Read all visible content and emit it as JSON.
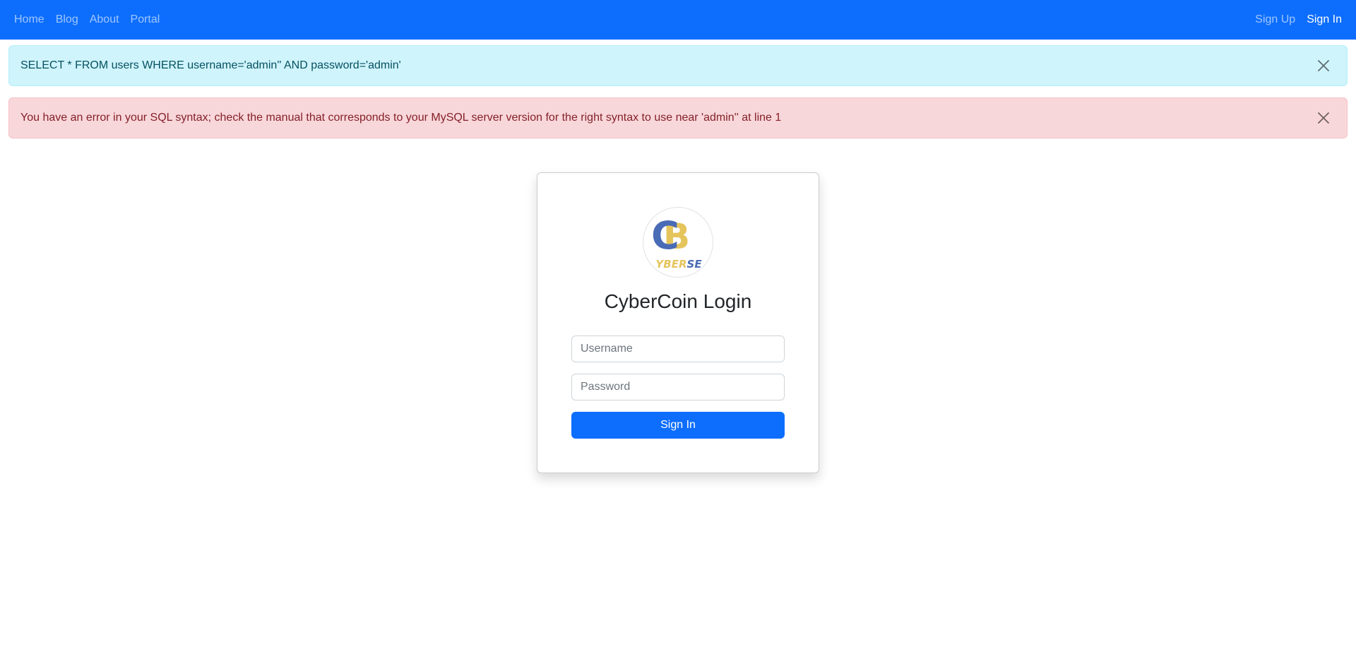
{
  "navbar": {
    "left_links": [
      {
        "label": "Home"
      },
      {
        "label": "Blog"
      },
      {
        "label": "About"
      },
      {
        "label": "Portal"
      }
    ],
    "signup_label": "Sign Up",
    "signin_label": "Sign In"
  },
  "alerts": {
    "info_text": "SELECT * FROM users WHERE username='admin'' AND password='admin'",
    "error_text": "You have an error in your SQL syntax; check the manual that corresponds to your MySQL server version for the right syntax to use near 'admin'' at line 1"
  },
  "login": {
    "logo": {
      "main_letters": "CB",
      "sub_text": "CYBERSEC"
    },
    "title": "CyberCoin Login",
    "username_placeholder": "Username",
    "password_placeholder": "Password",
    "submit_label": "Sign In"
  },
  "colors": {
    "primary": "#0d6efd",
    "info_bg": "#cff4fc",
    "danger_bg": "#f8d7da",
    "logo_blue": "#4a6bb5",
    "logo_gold": "#e6c45c"
  },
  "icons": {
    "alert_close": "close-icon",
    "logo": "cybercoin-logo"
  }
}
